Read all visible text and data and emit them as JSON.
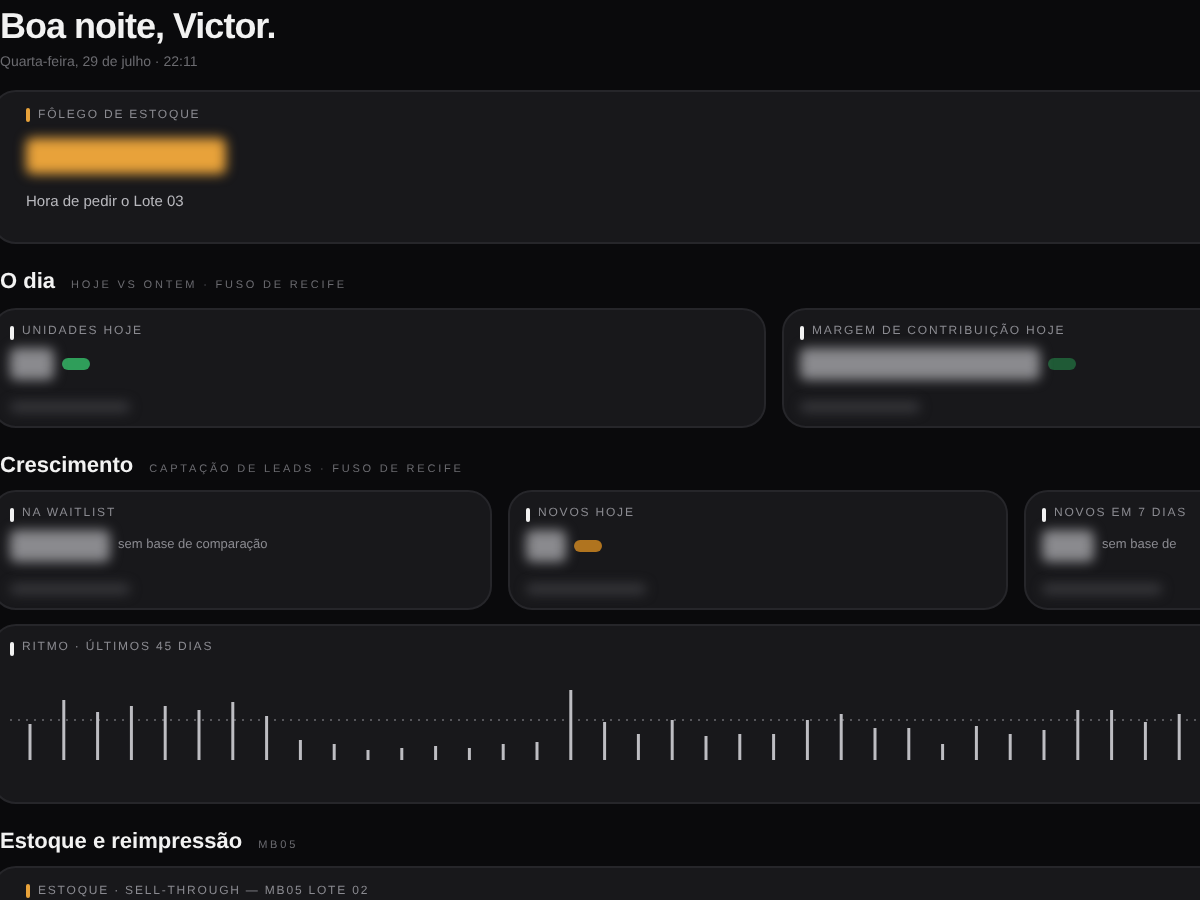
{
  "greeting": {
    "title": "Boa noite, Victor.",
    "subtitle": "Quarta-feira, 29 de julho · 22:11"
  },
  "hero": {
    "label": "FÔLEGO DE ESTOQUE",
    "value": {
      "kind": "blurred"
    },
    "note": "Hora de pedir o Lote 03"
  },
  "sections": [
    {
      "title": "O dia",
      "caption": "HOJE VS ONTEM · FUSO DE RECIFE",
      "cards": [
        {
          "label": "UNIDADES HOJE",
          "value": {
            "kind": "blurred"
          },
          "color": "#2f9e5a"
        },
        {
          "label": "MARGEM DE CONTRIBUIÇÃO HOJE",
          "value": {
            "kind": "blurred"
          },
          "color": "#1f5a36"
        }
      ]
    },
    {
      "title": "Crescimento",
      "caption": "CAPTAÇÃO DE LEADS · FUSO DE RECIFE",
      "cards": [
        {
          "label": "NA WAITLIST",
          "value": {
            "kind": "blurred"
          },
          "comparison": "sem base de comparação"
        },
        {
          "label": "NOVOS HOJE",
          "value": {
            "kind": "blurred"
          },
          "color": "#b0741f"
        },
        {
          "label": "NOVOS EM 7 DIAS",
          "value": {
            "kind": "blurred"
          },
          "comparison": "sem base de"
        }
      ]
    }
  ],
  "rhythm": {
    "label": "RITMO · ÚLTIMOS 45 DIAS"
  },
  "stock": {
    "title": "Estoque e reimpressão",
    "caption": "MB05",
    "card_label": "ESTOQUE · SELL-THROUGH — MB05 LOTE 02"
  }
}
